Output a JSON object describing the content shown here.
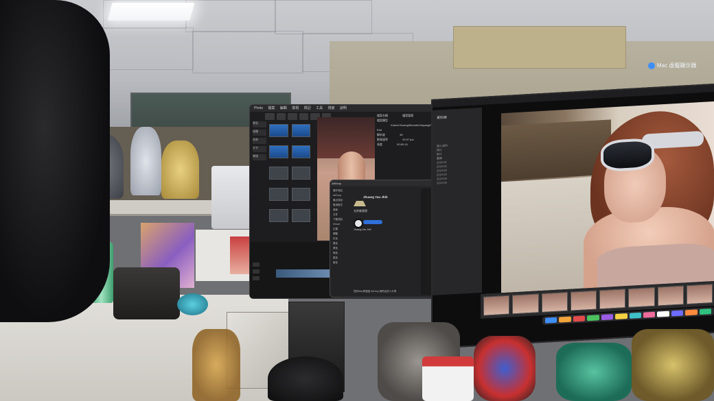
{
  "scene": "photo of an office desk with a mixed-reality headset view showing floating app windows",
  "app_window": {
    "menu": [
      "Photo",
      "檔案",
      "編輯",
      "檢視",
      "標記",
      "工具",
      "視窗",
      "說明"
    ],
    "properties": [
      {
        "label": "檔案名稱",
        "value": "檔案管理"
      },
      {
        "label": "檔案類型",
        "value": "/Users/Jhuang/Monster/Jiayang/Final Edit"
      },
      {
        "label": "解析度",
        "value": "4K"
      },
      {
        "label": "影格速率",
        "value": "29.97 fps"
      },
      {
        "label": "長度",
        "value": "00:00:15"
      }
    ],
    "sidebar": [
      "專案",
      "媒體",
      "效果",
      "文字",
      "轉場"
    ]
  },
  "dialog": {
    "title": "AirDrop",
    "sidebar": [
      "喜好項目",
      "AirDrop",
      "最近項目",
      "應用程式",
      "桌面",
      "文件",
      "下載項目",
      "iCloud",
      "位置",
      "標籤",
      "紅色",
      "橙色",
      "黃色",
      "綠色",
      "藍色",
      "紫色"
    ],
    "user_name": "Jhuang Yau Jhih",
    "heading": "允許被發現",
    "device_label": "Jhuang Yau Jhih",
    "footer": "您的Mac會透過 AirDrop 與附近的人分享"
  },
  "monitor": {
    "sidebar_title": "資料庫",
    "folders": [
      "個人資料",
      "照片",
      "影片",
      "圖庫",
      "2024-01",
      "2024-02",
      "2024-03",
      "2024-04",
      "2024-05",
      "2024-06"
    ]
  },
  "mac_badge": "Mac 虛擬顯示器",
  "dock_colors": [
    "#3f8ef7",
    "#f2a33a",
    "#e24b4b",
    "#4cc25e",
    "#9b5de5",
    "#f5d142",
    "#3fc1c9",
    "#ef6c9a",
    "#ffffff",
    "#6c6cff",
    "#ff8a3d",
    "#2ec27e"
  ]
}
